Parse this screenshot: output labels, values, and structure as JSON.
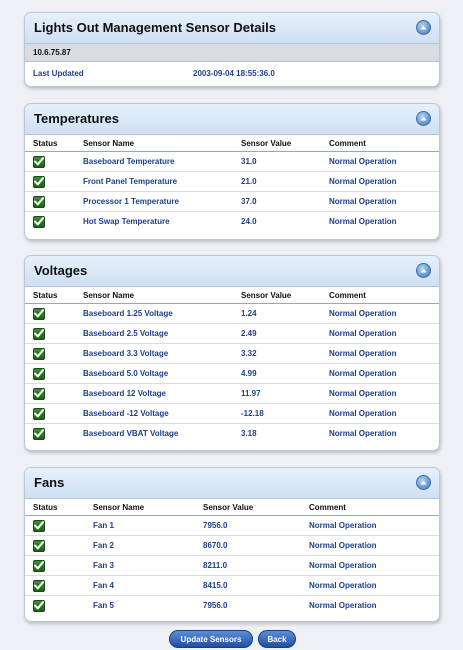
{
  "details": {
    "title": "Lights Out Management Sensor Details",
    "ip": "10.6.75.87",
    "last_updated_label": "Last Updated",
    "last_updated_value": "2003-09-04 18:55:36.0"
  },
  "temperatures": {
    "title": "Temperatures",
    "headers": {
      "status": "Status",
      "name": "Sensor Name",
      "value": "Sensor Value",
      "comment": "Comment"
    },
    "rows": [
      {
        "name": "Baseboard Temperature",
        "value": "31.0",
        "comment": "Normal Operation"
      },
      {
        "name": "Front Panel Temperature",
        "value": "21.0",
        "comment": "Normal Operation"
      },
      {
        "name": "Processor 1 Temperature",
        "value": "37.0",
        "comment": "Normal Operation"
      },
      {
        "name": "Hot Swap Temperature",
        "value": "24.0",
        "comment": "Normal Operation"
      }
    ]
  },
  "voltages": {
    "title": "Voltages",
    "headers": {
      "status": "Status",
      "name": "Sensor Name",
      "value": "Sensor Value",
      "comment": "Comment"
    },
    "rows": [
      {
        "name": "Baseboard 1.25 Voltage",
        "value": "1.24",
        "comment": "Normal Operation"
      },
      {
        "name": "Baseboard 2.5 Voltage",
        "value": "2.49",
        "comment": "Normal Operation"
      },
      {
        "name": "Baseboard 3.3 Voltage",
        "value": "3.32",
        "comment": "Normal Operation"
      },
      {
        "name": "Baseboard 5.0 Voltage",
        "value": "4.99",
        "comment": "Normal Operation"
      },
      {
        "name": "Baseboard 12 Voltage",
        "value": "11.97",
        "comment": "Normal Operation"
      },
      {
        "name": "Baseboard -12 Voltage",
        "value": "-12.18",
        "comment": "Normal Operation"
      },
      {
        "name": "Baseboard VBAT Voltage",
        "value": "3.18",
        "comment": "Normal Operation"
      }
    ]
  },
  "fans": {
    "title": "Fans",
    "headers": {
      "status": "Status",
      "name": "Sensor Name",
      "value": "Sensor Value",
      "comment": "Comment"
    },
    "rows": [
      {
        "name": "Fan 1",
        "value": "7956.0",
        "comment": "Normal Operation"
      },
      {
        "name": "Fan 2",
        "value": "8670.0",
        "comment": "Normal Operation"
      },
      {
        "name": "Fan 3",
        "value": "8211.0",
        "comment": "Normal Operation"
      },
      {
        "name": "Fan 4",
        "value": "8415.0",
        "comment": "Normal Operation"
      },
      {
        "name": "Fan 5",
        "value": "7956.0",
        "comment": "Normal Operation"
      }
    ]
  },
  "buttons": {
    "update": "Update Sensors",
    "back": "Back"
  },
  "icons": {
    "status": "checkmark-icon",
    "collapse": "collapse-up-icon"
  },
  "colors": {
    "value_text": "#1d3f8a",
    "status_ok": "#2e7d2c",
    "header_bg": "#d6e5f6"
  }
}
